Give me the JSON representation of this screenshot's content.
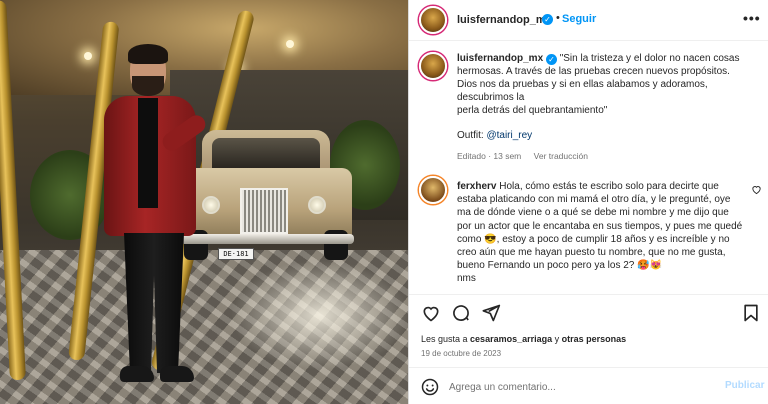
{
  "post": {
    "username": "luisfernandop_mx",
    "verified_glyph": "✓",
    "follow_label": "Seguir",
    "separator": "•",
    "more_label": "•••",
    "license_plate": "DE·181"
  },
  "caption": {
    "username": "luisfernandop_mx",
    "lines": [
      "\"Sin la tristeza y el dolor no nacen cosas",
      "hermosas. A través de las pruebas crecen nuevos propósitos.",
      "Dios nos da pruebas y si en ellas alabamos y adoramos,",
      "descubrimos la",
      "perla detrás del quebrantamiento\""
    ],
    "outfit_label": "Outfit:",
    "outfit_mention": "@tairi_rey",
    "edited": "Editado · 13 sem",
    "see_translation": "Ver traducción"
  },
  "comment": {
    "username": "ferxherv",
    "text": "Hola, cómo estás te escribo solo para decirte que estaba platicando con mi mamá el otro día, y le pregunté, oye ma de dónde viene o a qué se debe mi nombre y me dijo que por un actor que le encantaba en sus tiempos, y pues me quedé como 😎, estoy a poco de cumplir 18 años y es increíble y no creo aún que me hayan puesto tu nombre, que no me gusta, bueno Fernando un poco pero ya los 2? 🥵😻",
    "text_end": "nms"
  },
  "likes": {
    "prefix": "Les gusta a ",
    "user": "cesaramos_arriaga",
    "middle": " y ",
    "others": "otras personas"
  },
  "date": "19 de octubre de 2023",
  "add_comment": {
    "placeholder": "Agrega un comentario...",
    "publish_label": "Publicar"
  },
  "colors": {
    "accent": "#0095f6",
    "publish_disabled": "#b3dbff",
    "jacket": "#a72525"
  },
  "icons": {
    "like": "heart-icon",
    "comment": "comment-icon",
    "share": "send-icon",
    "save": "bookmark-icon",
    "emoji": "smiley-icon",
    "more": "more-options-icon",
    "verified": "verified-badge-icon"
  }
}
